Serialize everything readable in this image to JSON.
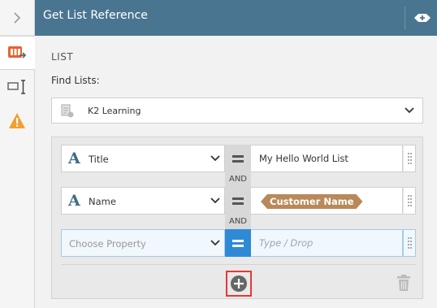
{
  "header": {
    "title": "Get List Reference"
  },
  "section": {
    "title": "LIST"
  },
  "find": {
    "label": "Find Lists:",
    "selected": "K2 Learning"
  },
  "filters": [
    {
      "property": "Title",
      "operator": "=",
      "value": "My Hello World List",
      "value_type": "text"
    },
    {
      "property": "Name",
      "operator": "=",
      "value": "Customer Name",
      "value_type": "token"
    },
    {
      "property_placeholder": "Choose Property",
      "operator": "=",
      "value_placeholder": "Type / Drop"
    }
  ],
  "connector": "AND",
  "colors": {
    "header": "#4a7590",
    "accent": "#2f8ad6",
    "token": "#b8895a",
    "highlight": "#e53935",
    "warning": "#f0a030",
    "rail_active": "#e8602c"
  }
}
